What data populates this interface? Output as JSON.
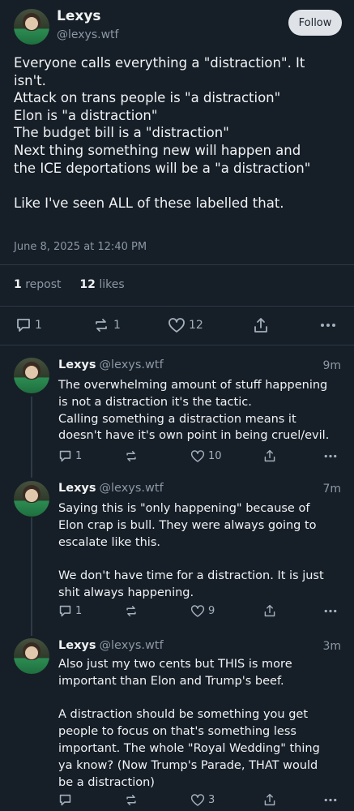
{
  "main_post": {
    "author": "Lexys",
    "handle": "@lexys.wtf",
    "follow_label": "Follow",
    "lines": [
      "Everyone calls everything a \"distraction\". It",
      "isn't.",
      "Attack on trans people is \"a distraction\"",
      "Elon is \"a distraction\"",
      "The budget bill is a \"distraction\"",
      "Next thing something new will happen and",
      "the ICE deportations will be a \"a distraction\"",
      "",
      "Like I've seen ALL of these labelled that."
    ],
    "date": "June 8, 2025 at 12:40 PM",
    "reposts_count": "1",
    "reposts_label": "repost",
    "likes_count": "12",
    "likes_label": "likes",
    "actions": {
      "replies": "1",
      "reposts": "1",
      "likes": "12"
    }
  },
  "replies": [
    {
      "author": "Lexys",
      "handle": "@lexys.wtf",
      "time": "9m",
      "lines": [
        "The overwhelming amount of stuff happening",
        "is not a distraction it's the tactic.",
        "Calling something a distraction means it",
        "doesn't have it's own point in being cruel/evil."
      ],
      "actions": {
        "replies": "1",
        "reposts": "",
        "likes": "10"
      }
    },
    {
      "author": "Lexys",
      "handle": "@lexys.wtf",
      "time": "7m",
      "lines": [
        "Saying this is \"only happening\" because of",
        "Elon crap is bull. They were always going to",
        "escalate like this.",
        "",
        "We don't have time for a distraction. It is just",
        "shit always happening."
      ],
      "actions": {
        "replies": "1",
        "reposts": "",
        "likes": "9"
      }
    },
    {
      "author": "Lexys",
      "handle": "@lexys.wtf",
      "time": "3m",
      "lines": [
        "Also just my two cents but THIS is more",
        "important than Elon and Trump's beef.",
        "",
        "A distraction should be something you get",
        "people to focus on that's something less",
        "important. The whole \"Royal Wedding\" thing",
        "ya know? (Now Trump's Parade, THAT would",
        "be a distraction)"
      ],
      "actions": {
        "replies": "",
        "reposts": "",
        "likes": "3"
      }
    }
  ],
  "colors": {
    "background": "#161e27",
    "text": "#f1f3f5",
    "muted": "#8b98a5",
    "divider": "#2e3a47"
  }
}
